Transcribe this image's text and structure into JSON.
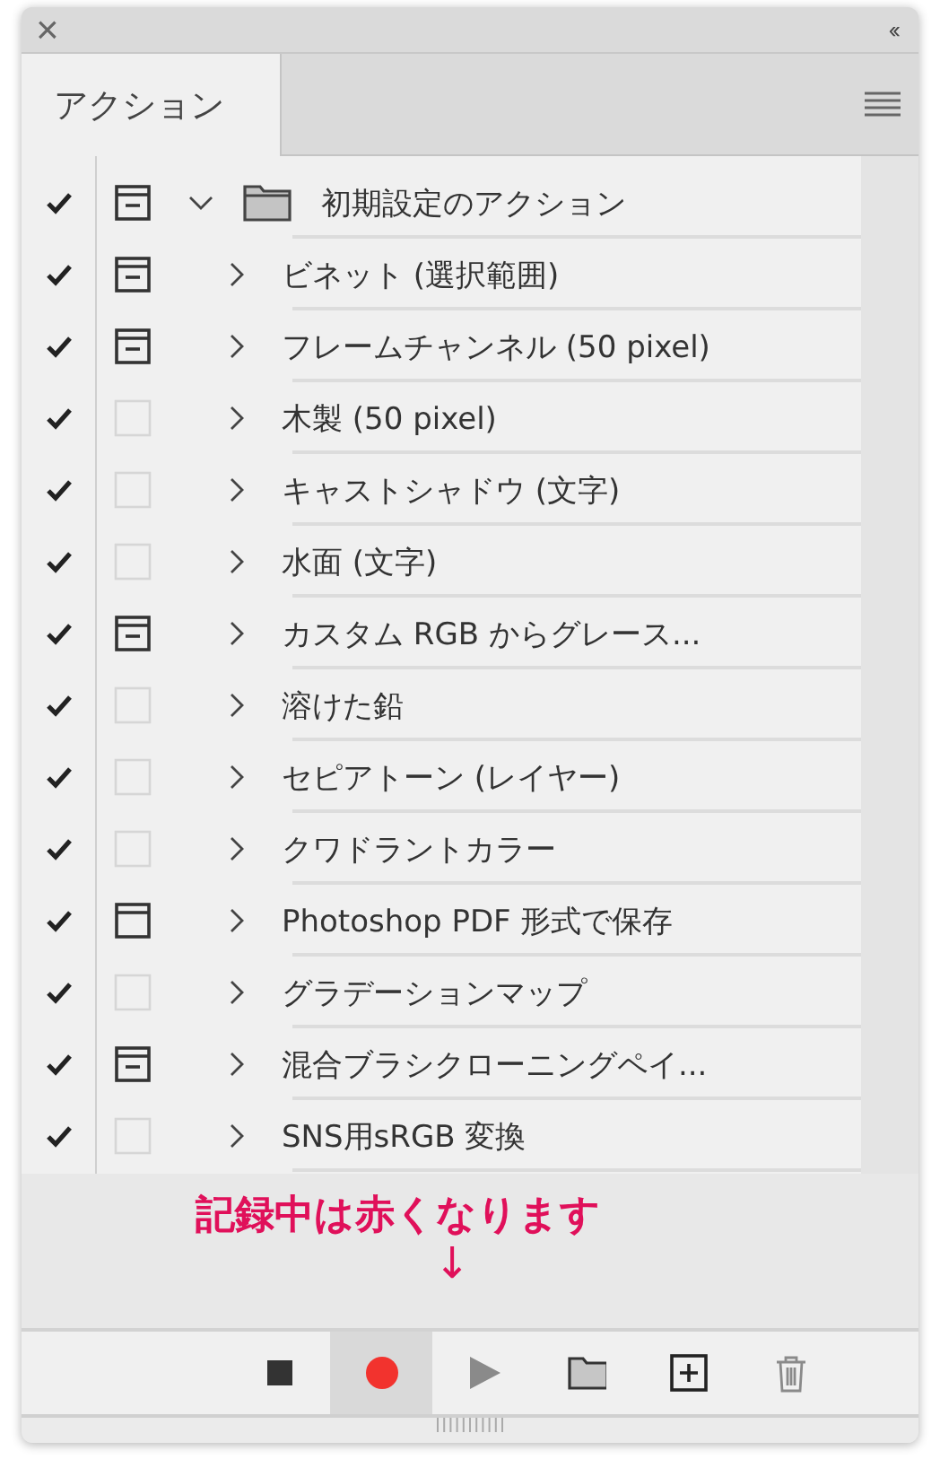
{
  "window": {
    "close": "×",
    "collapse": "‹‹"
  },
  "tabs": [
    {
      "label": "アクション",
      "selected": true
    }
  ],
  "actions": [
    {
      "name": "初期設定のアクション",
      "kind": "set",
      "checked": true,
      "dialog": true,
      "dialog_partial": true,
      "expanded": true,
      "children": [
        {
          "name": "ビネット (選択範囲)",
          "checked": true,
          "dialog": true,
          "dialog_partial": true,
          "expanded": false
        },
        {
          "name": "フレームチャンネル (50 pixel)",
          "checked": true,
          "dialog": true,
          "dialog_partial": true,
          "expanded": false
        },
        {
          "name": "木製 (50 pixel)",
          "checked": true,
          "dialog": false,
          "expanded": false
        },
        {
          "name": "キャストシャドウ (文字)",
          "checked": true,
          "dialog": false,
          "expanded": false
        },
        {
          "name": "水面 (文字)",
          "checked": true,
          "dialog": false,
          "expanded": false
        },
        {
          "name": "カスタム RGB からグレース...",
          "checked": true,
          "dialog": true,
          "dialog_partial": true,
          "expanded": false
        },
        {
          "name": "溶けた鉛",
          "checked": true,
          "dialog": false,
          "expanded": false
        },
        {
          "name": "セピアトーン (レイヤー)",
          "checked": true,
          "dialog": false,
          "expanded": false
        },
        {
          "name": "クワドラントカラー",
          "checked": true,
          "dialog": false,
          "expanded": false
        },
        {
          "name": "Photoshop PDF 形式で保存",
          "checked": true,
          "dialog": true,
          "dialog_partial": false,
          "expanded": false
        },
        {
          "name": "グラデーションマップ",
          "checked": true,
          "dialog": false,
          "expanded": false
        },
        {
          "name": "混合ブラシクローニングペイ...",
          "checked": true,
          "dialog": true,
          "dialog_partial": true,
          "expanded": false
        },
        {
          "name": "SNS用sRGB 変換",
          "checked": true,
          "dialog": false,
          "expanded": false
        }
      ]
    }
  ],
  "annotation": {
    "text": "記録中は赤くなります",
    "arrow": "↓"
  },
  "toolbar": [
    {
      "kind": "stop",
      "selected": false
    },
    {
      "kind": "record",
      "selected": true
    },
    {
      "kind": "play",
      "selected": false
    },
    {
      "kind": "new-set",
      "selected": false
    },
    {
      "kind": "new-action",
      "selected": false
    },
    {
      "kind": "delete",
      "selected": false
    }
  ]
}
